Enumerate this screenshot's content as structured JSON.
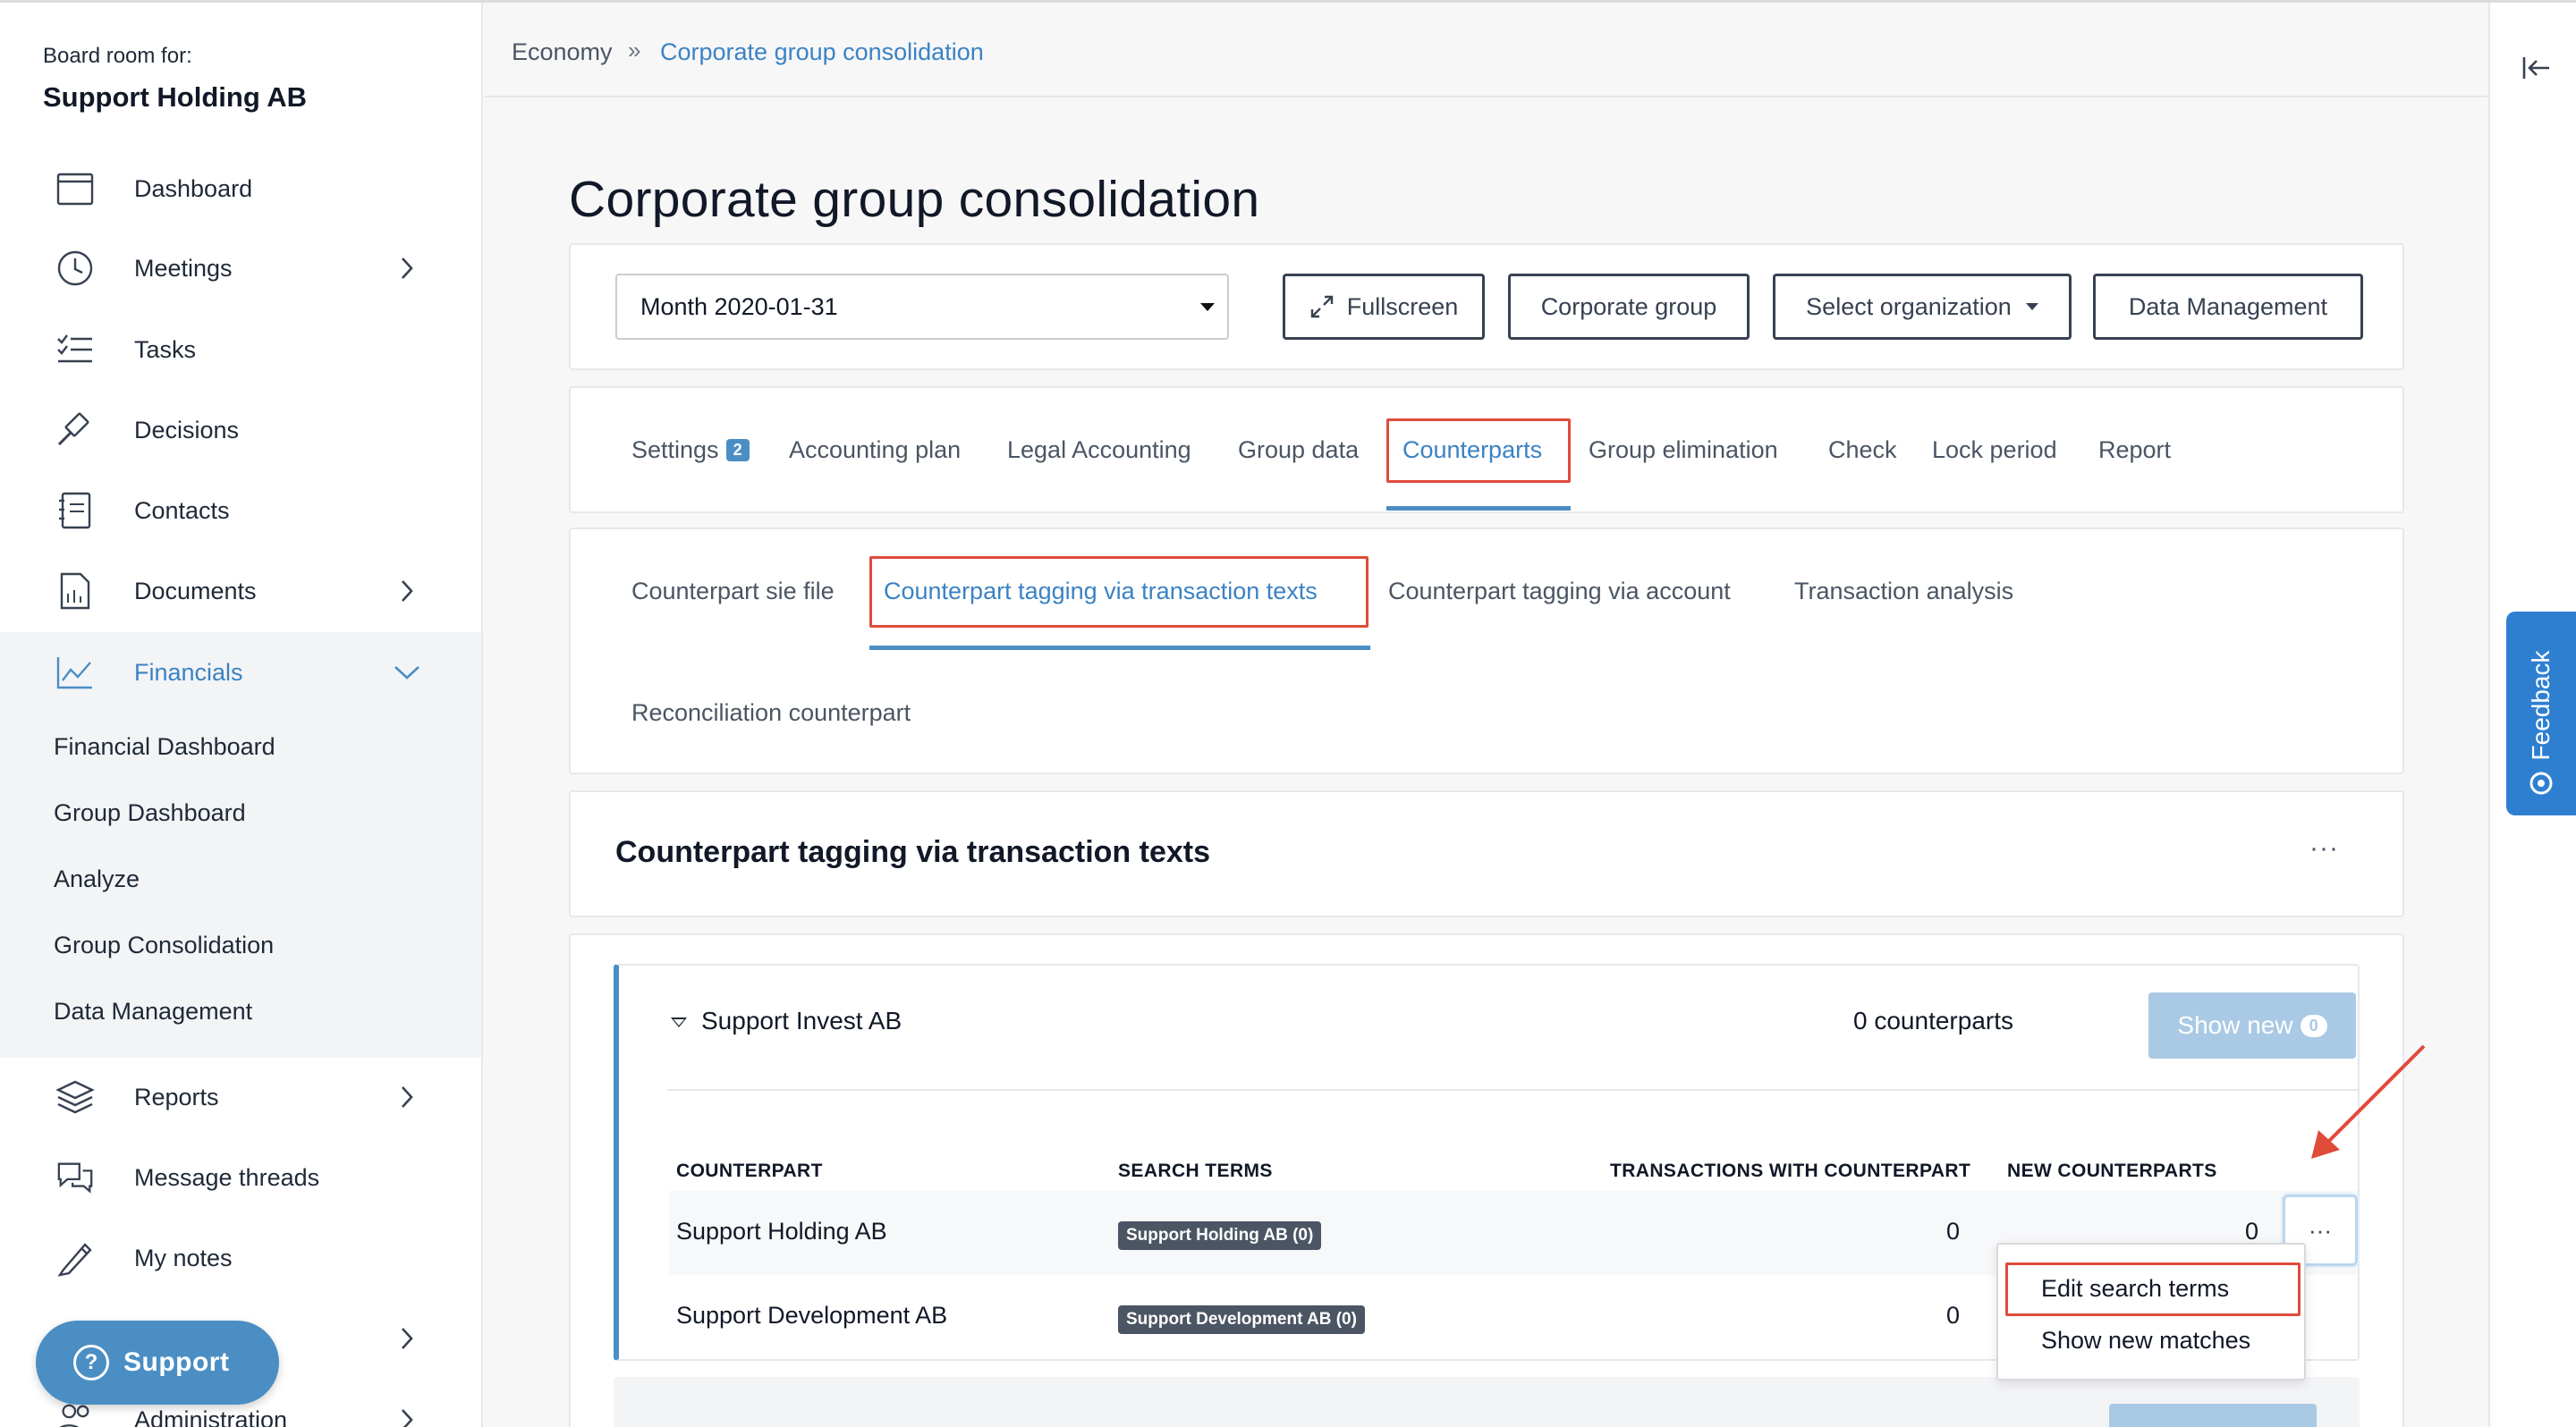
{
  "sidebar": {
    "board_label": "Board room for:",
    "board_name": "Support Holding AB",
    "items": [
      {
        "label": "Dashboard",
        "icon": "calendar-icon"
      },
      {
        "label": "Meetings",
        "icon": "clock-icon"
      },
      {
        "label": "Tasks",
        "icon": "checklist-icon"
      },
      {
        "label": "Decisions",
        "icon": "gavel-icon"
      },
      {
        "label": "Contacts",
        "icon": "contacts-book-icon"
      },
      {
        "label": "Documents",
        "icon": "document-icon"
      },
      {
        "label": "Financials",
        "icon": "line-chart-icon"
      },
      {
        "label": "Reports",
        "icon": "layers-icon"
      },
      {
        "label": "Message threads",
        "icon": "chat-bubbles-icon"
      },
      {
        "label": "My notes",
        "icon": "pencil-icon"
      },
      {
        "label": "Administration",
        "icon": "users-icon"
      }
    ],
    "financials_sub": [
      "Financial Dashboard",
      "Group Dashboard",
      "Analyze",
      "Group Consolidation",
      "Data Management"
    ],
    "support_label": "Support"
  },
  "breadcrumb": {
    "parent": "Economy",
    "separator": "»",
    "current": "Corporate group consolidation"
  },
  "page_title": "Corporate group consolidation",
  "controls": {
    "period_value": "Month 2020-01-31",
    "fullscreen_label": "Fullscreen",
    "corporate_group_label": "Corporate group",
    "select_org_label": "Select organization",
    "data_management_label": "Data Management"
  },
  "tabs": [
    {
      "label": "Settings",
      "badge": "2"
    },
    {
      "label": "Accounting plan"
    },
    {
      "label": "Legal Accounting"
    },
    {
      "label": "Group data"
    },
    {
      "label": "Counterparts"
    },
    {
      "label": "Group elimination"
    },
    {
      "label": "Check"
    },
    {
      "label": "Lock period"
    },
    {
      "label": "Report"
    }
  ],
  "subtabs": [
    "Counterpart sie file",
    "Counterpart tagging via transaction texts",
    "Counterpart tagging via account",
    "Transaction analysis",
    "Reconciliation counterpart"
  ],
  "section": {
    "title": "Counterpart tagging via transaction texts",
    "menu": "···"
  },
  "entity": {
    "name": "Support Invest AB",
    "count_text": "0 counterparts",
    "show_new_label": "Show new",
    "show_new_count": "0"
  },
  "table": {
    "columns": [
      "COUNTERPART",
      "SEARCH TERMS",
      "TRANSACTIONS WITH COUNTERPART",
      "NEW COUNTERPARTS"
    ],
    "rows": [
      {
        "counterpart": "Support Holding AB",
        "search_term": "Support Holding AB (0)",
        "transactions": "0",
        "new": "0"
      },
      {
        "counterpart": "Support Development AB",
        "search_term": "Support Development AB (0)",
        "transactions": "0",
        "new": ""
      }
    ],
    "row_menu": "···"
  },
  "dropdown": [
    "Edit search terms",
    "Show new matches"
  ],
  "feedback_label": "Feedback",
  "colors": {
    "accent": "#3b82c4",
    "highlight": "#e04b3a",
    "feedback": "#2f7fd1"
  }
}
